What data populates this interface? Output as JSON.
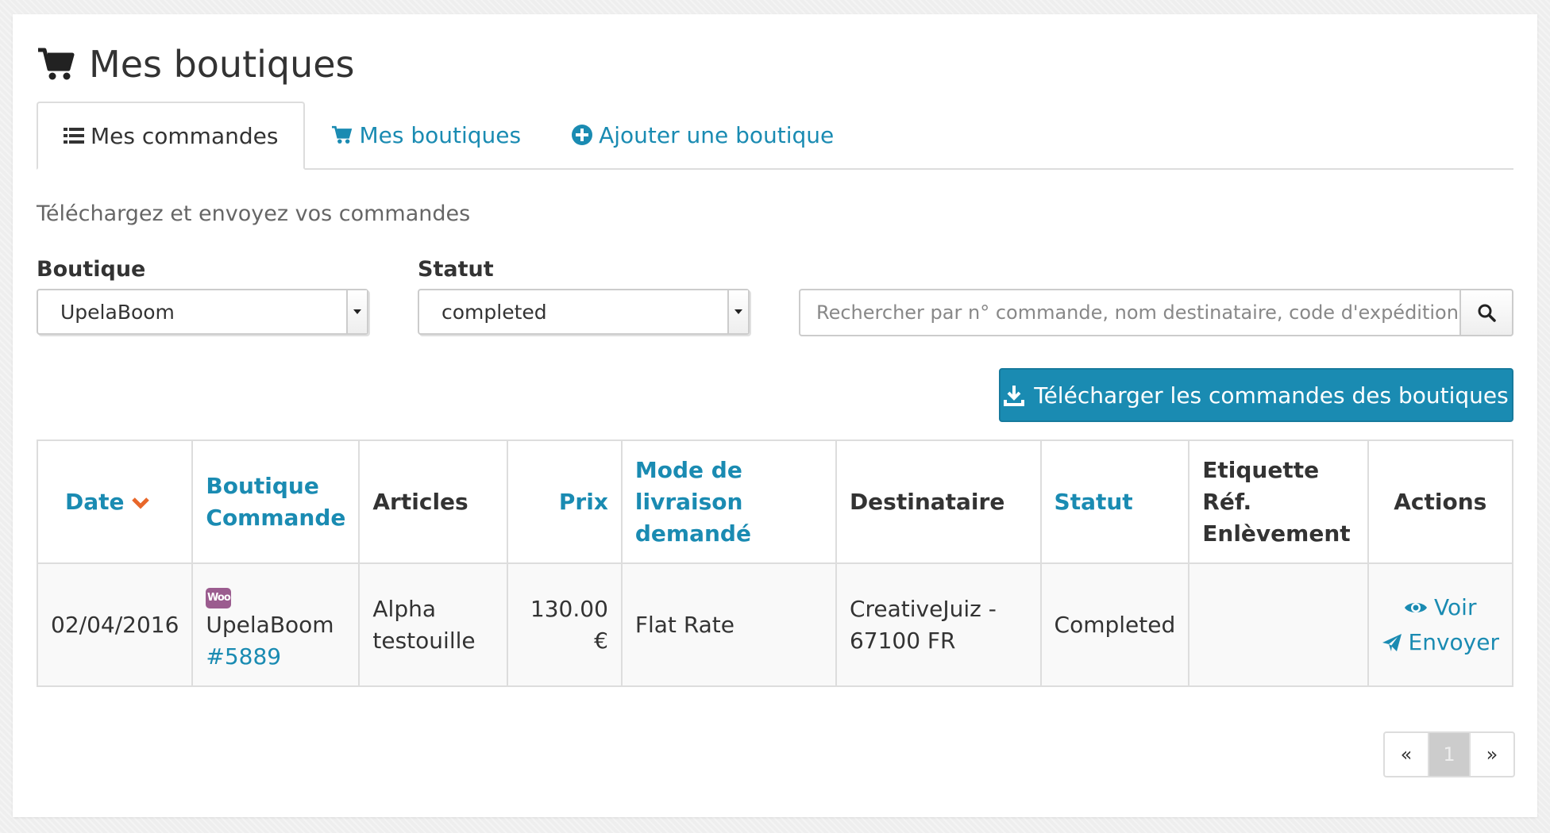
{
  "page": {
    "title": "Mes boutiques",
    "icon": "shopping-cart-icon"
  },
  "tabs": [
    {
      "label": "Mes commandes",
      "icon": "list-icon",
      "active": true
    },
    {
      "label": "Mes boutiques",
      "icon": "shopping-cart-icon",
      "active": false
    },
    {
      "label": "Ajouter une boutique",
      "icon": "plus-circle-icon",
      "active": false
    }
  ],
  "subtitle": "Téléchargez et envoyez vos commandes",
  "filters": {
    "boutique_label": "Boutique",
    "boutique_value": "UpelaBoom",
    "statut_label": "Statut",
    "statut_value": "completed",
    "search_placeholder": "Rechercher par n° commande, nom destinataire, code d'expédition ou"
  },
  "download_button": "Télécharger les commandes des boutiques",
  "table": {
    "headers": {
      "date": "Date",
      "boutique_line1": "Boutique",
      "boutique_line2": "Commande",
      "articles": "Articles",
      "prix": "Prix",
      "mode_line1": "Mode de livraison",
      "mode_line2": "demandé",
      "destinataire": "Destinataire",
      "statut": "Statut",
      "etiquette_line1": "Etiquette",
      "etiquette_line2": "Réf.",
      "etiquette_line3": "Enlèvement",
      "actions": "Actions"
    },
    "row": {
      "date": "02/04/2016",
      "shop_badge": "Woo",
      "shop": "UpelaBoom",
      "order": "#5889",
      "articles_line1": "Alpha",
      "articles_line2": "testouille",
      "prix": "130.00 €",
      "mode": "Flat Rate",
      "dest_line1": "CreativeJuiz -",
      "dest_line2": "67100 FR",
      "statut": "Completed",
      "etiquette": "",
      "action_view": "Voir",
      "action_send": "Envoyer"
    }
  },
  "pagination": {
    "prev": "«",
    "current": "1",
    "next": "»"
  },
  "colors": {
    "accent": "#1a8bb2",
    "sort_arrow": "#e8672a",
    "woo": "#9b5c8f"
  }
}
